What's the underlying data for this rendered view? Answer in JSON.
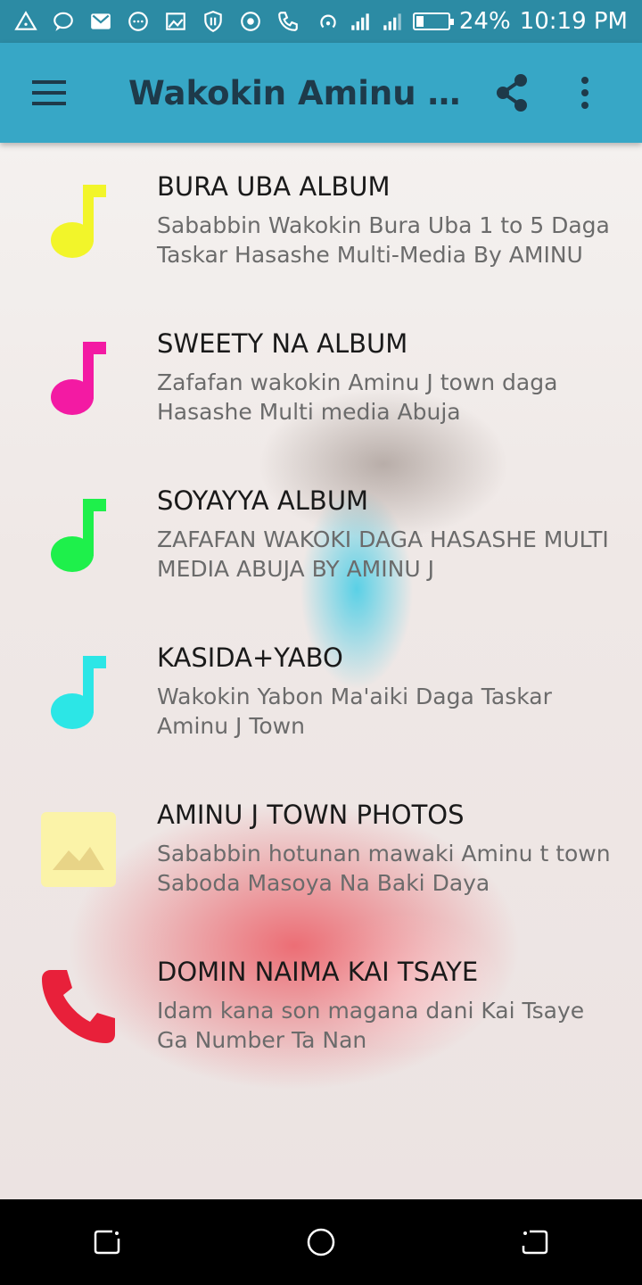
{
  "status_bar": {
    "battery": "24%",
    "battery_level": 0.24,
    "time": "10:19 PM",
    "icons": [
      "warning-triangle-icon",
      "chat-icon",
      "gmail-icon",
      "messages-icon",
      "image-notification-icon",
      "shield-icon",
      "record-icon",
      "call-icon",
      "hotspot-icon",
      "signal-icon",
      "signal-icon",
      "battery-icon"
    ]
  },
  "app_bar": {
    "title": "Wakokin Aminu J T...",
    "menu_icon": "hamburger-menu-icon",
    "share_icon": "share-icon",
    "more_icon": "more-vertical-icon",
    "color": "#37a7c6"
  },
  "items": [
    {
      "title": "BURA UBA ALBUM",
      "subtitle": "Sababbin Wakokin Bura Uba 1 to 5 Daga Taskar Hasashe Multi-Media By AMINU",
      "icon": "music-note-icon",
      "color": "#f2f52a"
    },
    {
      "title": "SWEETY NA ALBUM",
      "subtitle": "Zafafan wakokin Aminu J town daga Hasashe Multi media Abuja",
      "icon": "music-note-icon",
      "color": "#f31aa3"
    },
    {
      "title": "SOYAYYA ALBUM",
      "subtitle": "ZAFAFAN WAKOKI DAGA HASASHE MULTI MEDIA ABUJA BY  AMINU J",
      "icon": "music-note-icon",
      "color": "#1ef04b"
    },
    {
      "title": "KASIDA+YABO",
      "subtitle": "Wakokin Yabon Ma'aiki Daga Taskar Aminu J Town",
      "icon": "music-note-icon",
      "color": "#2ce6e6"
    },
    {
      "title": "AMINU J TOWN PHOTOS",
      "subtitle": "Sababbin hotunan mawaki Aminu t town Saboda Masoya Na Baki Daya",
      "icon": "image-icon",
      "color": "#fbf3a8"
    },
    {
      "title": "DOMIN NAIMA KAI TSAYE",
      "subtitle": "Idam kana son magana dani Kai Tsaye Ga Number Ta Nan",
      "icon": "phone-icon",
      "color": "#e8203a"
    }
  ],
  "nav_bar": {
    "recents_icon": "recents-icon",
    "home_icon": "home-icon",
    "back_icon": "back-icon"
  }
}
